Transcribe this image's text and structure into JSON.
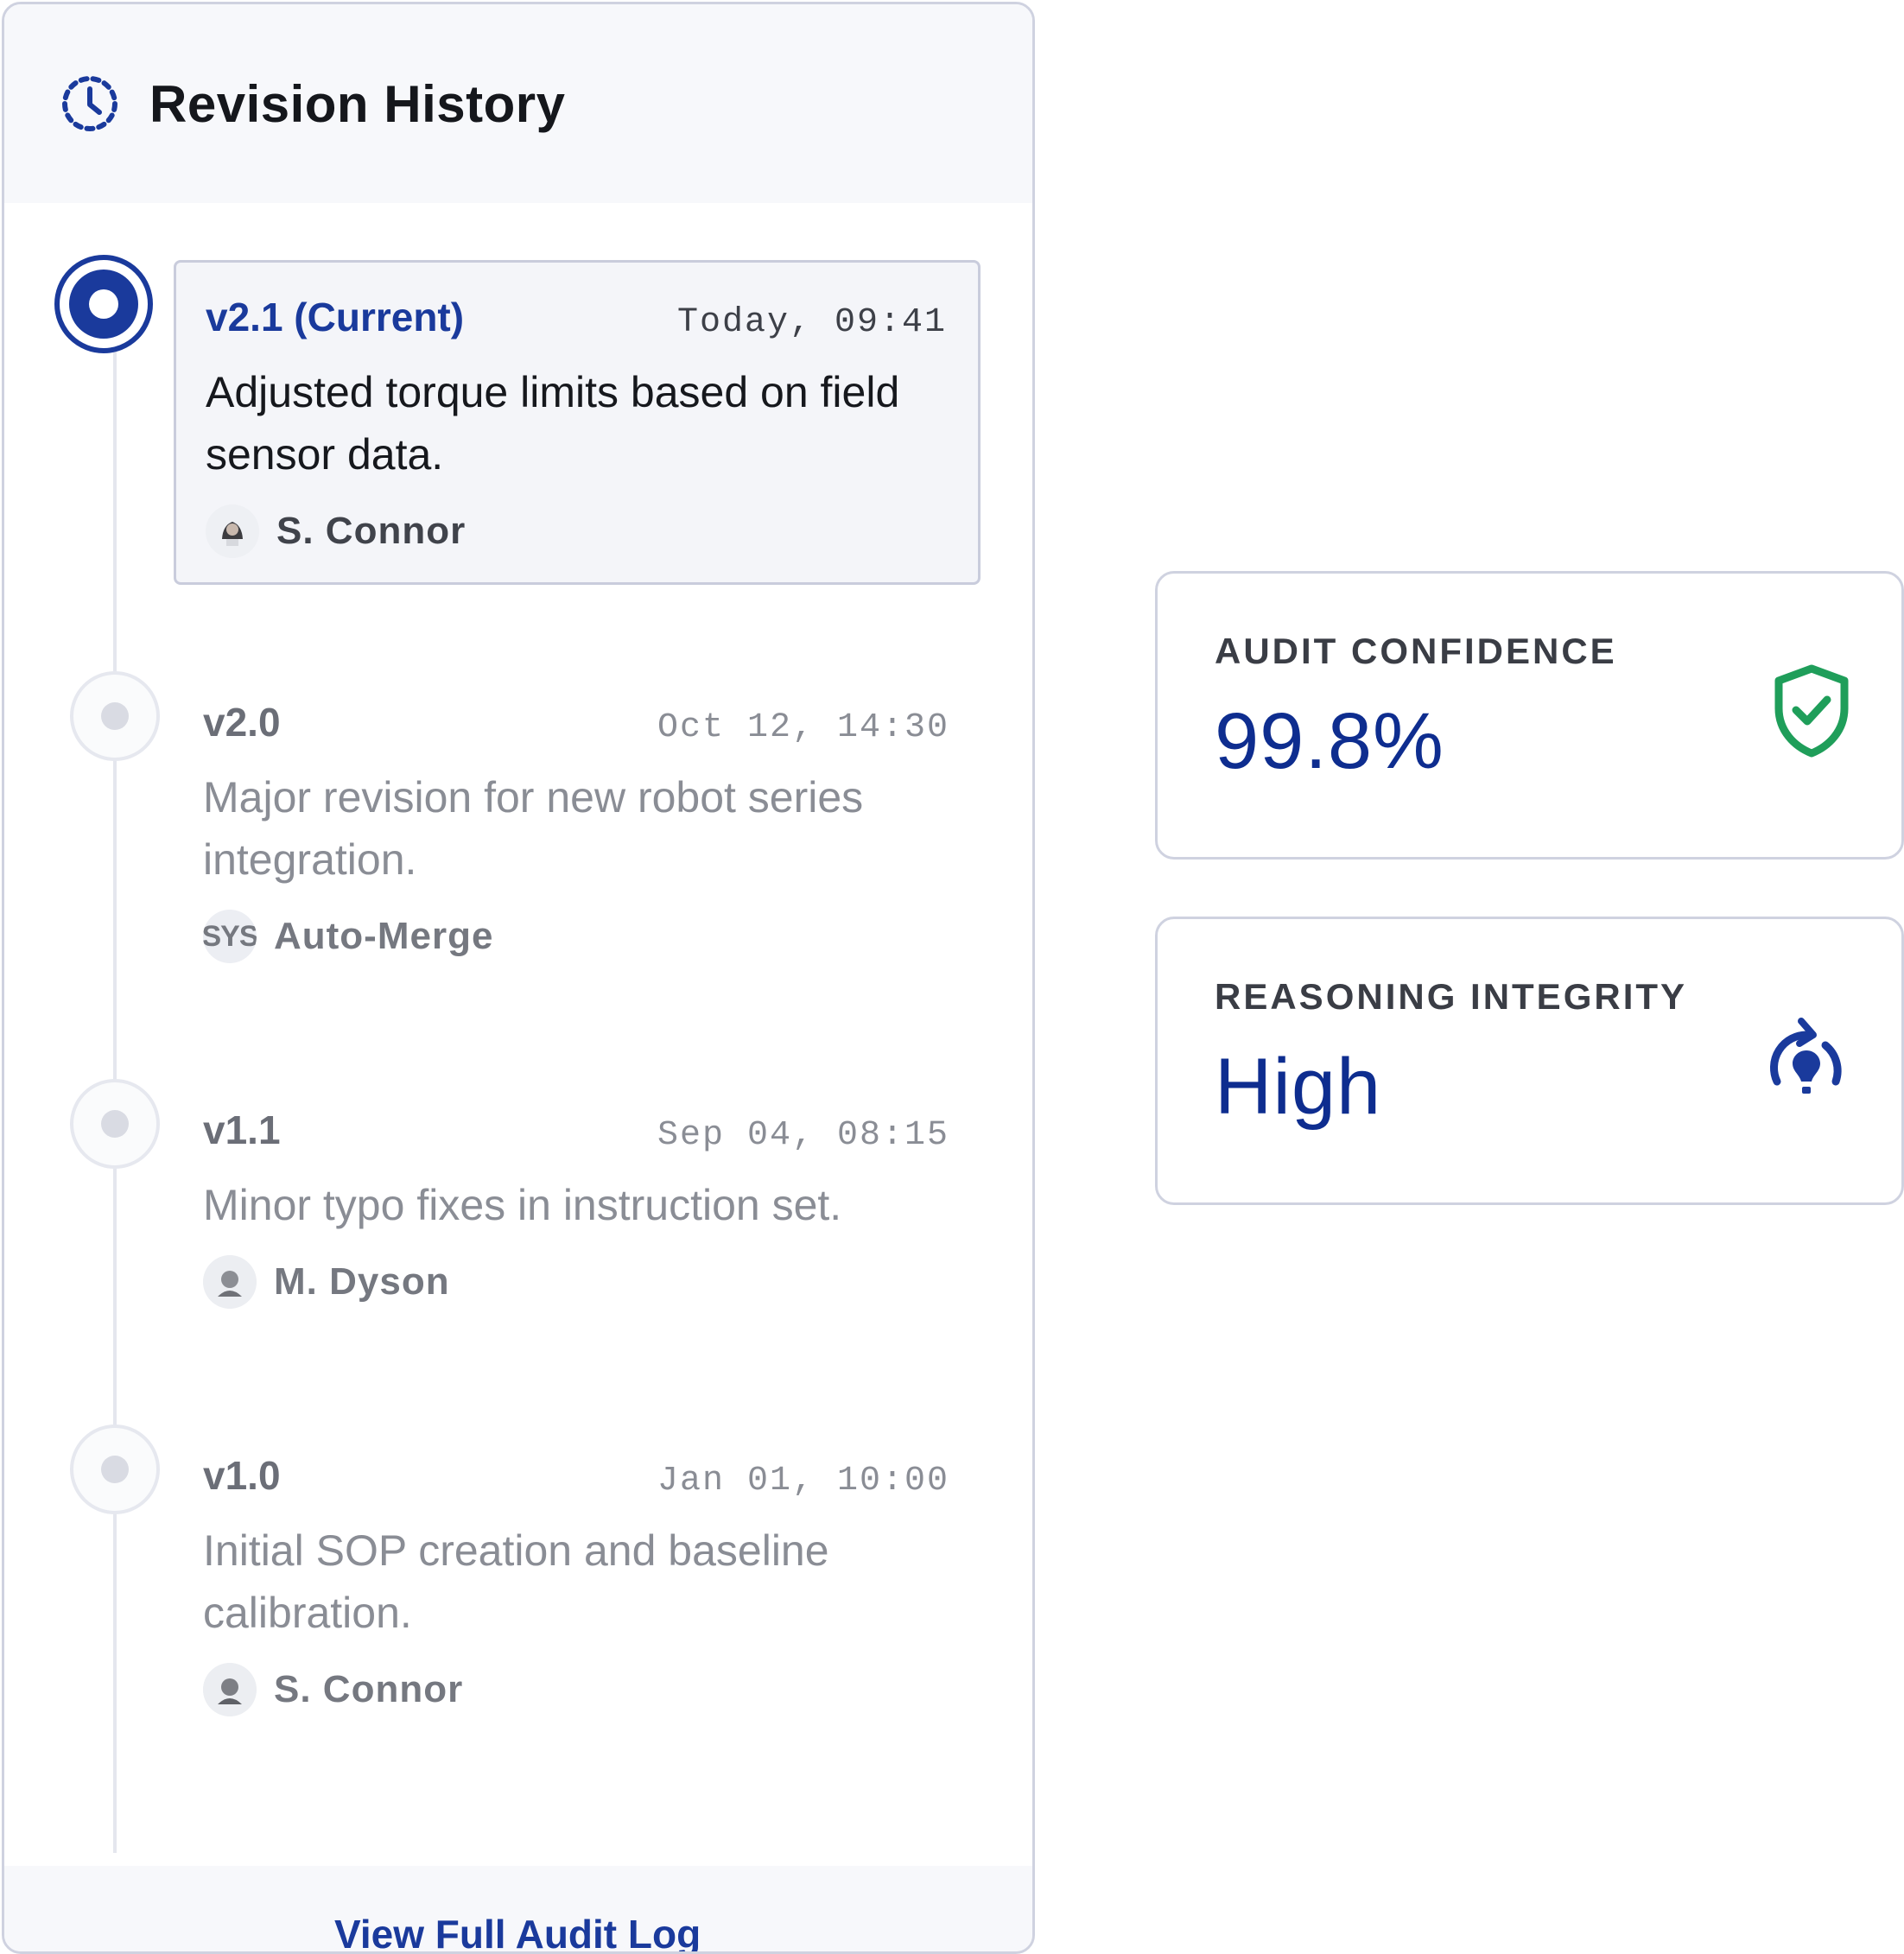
{
  "panel": {
    "title": "Revision History",
    "icon": "history-clock-icon",
    "footer_link": "View Full Audit Log"
  },
  "revisions": [
    {
      "version": "v2.1 (Current)",
      "timestamp": "Today, 09:41",
      "description": "Adjusted torque limits based on field sensor data.",
      "author": "S. Connor",
      "avatar": "avatar-photo",
      "current": true
    },
    {
      "version": "v2.0",
      "timestamp": "Oct 12, 14:30",
      "description": "Major revision for new robot series integration.",
      "author": "Auto-Merge",
      "avatar_text": "SYS",
      "current": false
    },
    {
      "version": "v1.1",
      "timestamp": "Sep 04, 08:15",
      "description": "Minor typo fixes in instruction set.",
      "author": "M. Dyson",
      "avatar": "avatar-photo",
      "current": false
    },
    {
      "version": "v1.0",
      "timestamp": "Jan 01, 10:00",
      "description": "Initial SOP creation and baseline calibration.",
      "author": "S. Connor",
      "avatar": "avatar-photo",
      "current": false
    }
  ],
  "metrics": {
    "audit_confidence": {
      "label": "AUDIT CONFIDENCE",
      "value": "99.8%",
      "icon": "shield-check-icon",
      "icon_color": "#1f9e5a"
    },
    "reasoning_integrity": {
      "label": "REASONING INTEGRITY",
      "value": "High",
      "icon": "reasoning-bulb-icon",
      "icon_color": "#1a3a9c"
    }
  },
  "colors": {
    "accent": "#1a3a9c",
    "value_text": "#0e2d8f",
    "border": "#cfd2e0",
    "header_bg": "#f7f8fb"
  }
}
